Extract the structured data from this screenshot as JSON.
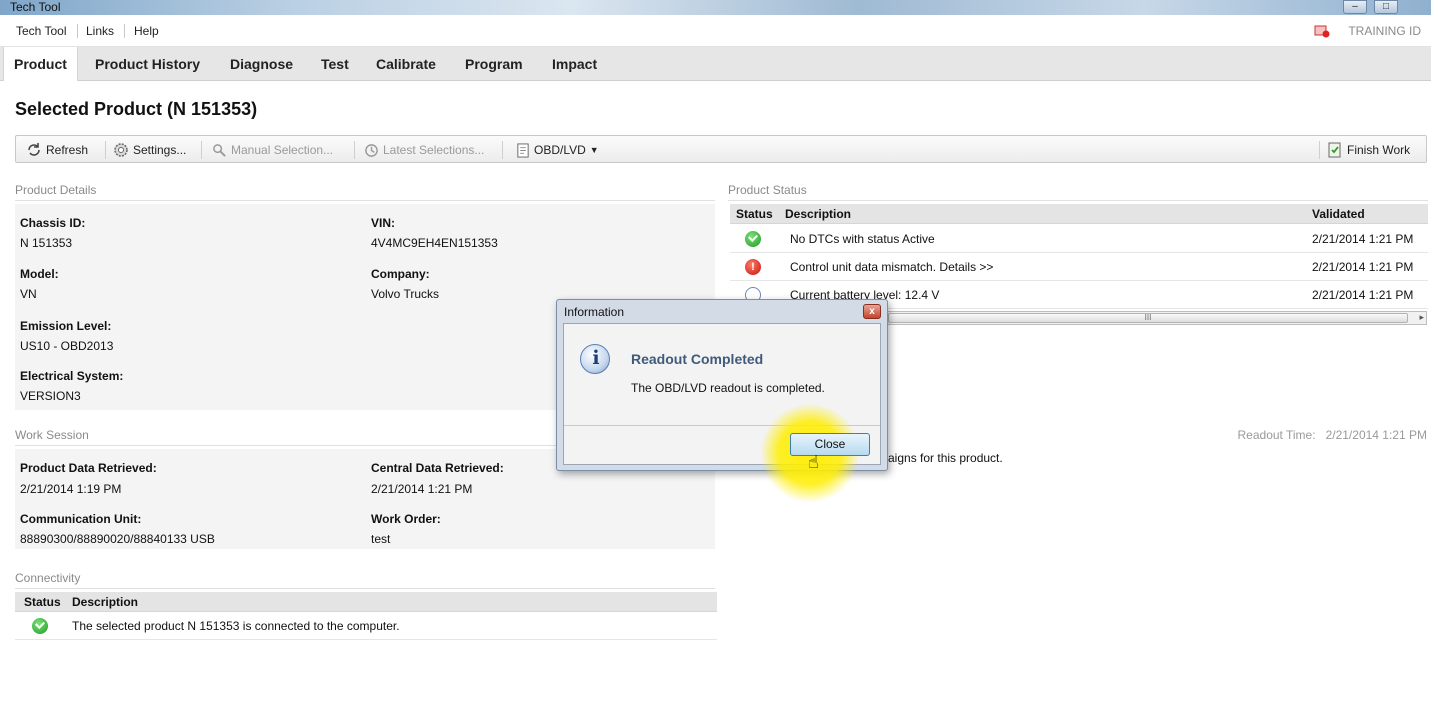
{
  "window": {
    "title": "Tech Tool",
    "buttons": [
      "–",
      "□"
    ]
  },
  "menu": {
    "items": [
      "Tech Tool",
      "Links",
      "Help"
    ],
    "training_id": "TRAINING ID"
  },
  "tabs": [
    "Product",
    "Product History",
    "Diagnose",
    "Test",
    "Calibrate",
    "Program",
    "Impact"
  ],
  "page_title": "Selected Product (N 151353)",
  "toolbar": {
    "refresh": "Refresh",
    "settings": "Settings...",
    "manual_selection": "Manual Selection...",
    "latest_selections": "Latest Selections...",
    "obd": "OBD/LVD",
    "finish_work": "Finish Work"
  },
  "product_details": {
    "title": "Product Details",
    "chassis_label": "Chassis ID:",
    "chassis_value": "N 151353",
    "vin_label": "VIN:",
    "vin_value": "4V4MC9EH4EN151353",
    "model_label": "Model:",
    "model_value": "VN",
    "company_label": "Company:",
    "company_value": "Volvo Trucks",
    "emission_label": "Emission Level:",
    "emission_value": "US10 - OBD2013",
    "electrical_label": "Electrical System:",
    "electrical_value": "VERSION3"
  },
  "work_session": {
    "title": "Work Session",
    "pdr_label": "Product Data Retrieved:",
    "pdr_value": "2/21/2014 1:19 PM",
    "cdr_label": "Central Data Retrieved:",
    "cdr_value": "2/21/2014 1:21 PM",
    "cu_label": "Communication Unit:",
    "cu_value": "88890300/88890020/88840133 USB",
    "wo_label": "Work Order:",
    "wo_value": "test"
  },
  "connectivity": {
    "title": "Connectivity",
    "col_status": "Status",
    "col_description": "Description",
    "row_text": "The selected product N 151353 is connected to the computer."
  },
  "product_status": {
    "title": "Product Status",
    "col_status": "Status",
    "col_description": "Description",
    "col_validated": "Validated",
    "rows": [
      {
        "status": "ok",
        "description": "No DTCs with status Active",
        "validated": "2/21/2014 1:21 PM"
      },
      {
        "status": "error",
        "description": "Control unit data mismatch. Details >>",
        "validated": "2/21/2014 1:21 PM"
      },
      {
        "status": "info",
        "description": "Current battery level: 12.4 V",
        "validated": "2/21/2014 1:21 PM"
      }
    ],
    "scroll_grip": "III"
  },
  "readout_time": {
    "label": "Readout Time:",
    "value": "2/21/2014 1:21 PM"
  },
  "campaign_text": "aigns for this product.",
  "dialog": {
    "title": "Information",
    "close_x": "x",
    "heading": "Readout Completed",
    "message": "The OBD/LVD readout is completed.",
    "close_button": "Close"
  }
}
